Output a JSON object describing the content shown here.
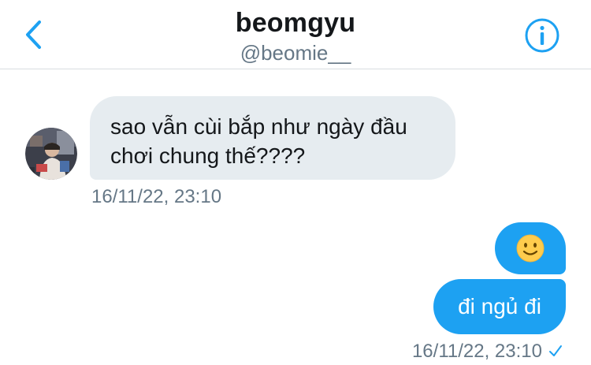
{
  "header": {
    "title": "beomgyu",
    "handle": "@beomie__",
    "back_icon": "chevron-left-icon",
    "info_icon": "info-circle-icon",
    "accent_color": "#1da1f2"
  },
  "messages": [
    {
      "direction": "incoming",
      "text": "sao vẫn cùi bắp như ngày đầu chơi chung thế????",
      "timestamp": "16/11/22, 23:10",
      "avatar": "avatar-photo"
    },
    {
      "direction": "outgoing",
      "emoji": "smiling-face-emoji"
    },
    {
      "direction": "outgoing",
      "text": "đi ngủ đi",
      "timestamp": "16/11/22, 23:10",
      "status_icon": "sent-check-icon"
    }
  ],
  "colors": {
    "incoming_bubble": "#e6ecf0",
    "outgoing_bubble": "#1da1f2",
    "timestamp": "#657786"
  }
}
